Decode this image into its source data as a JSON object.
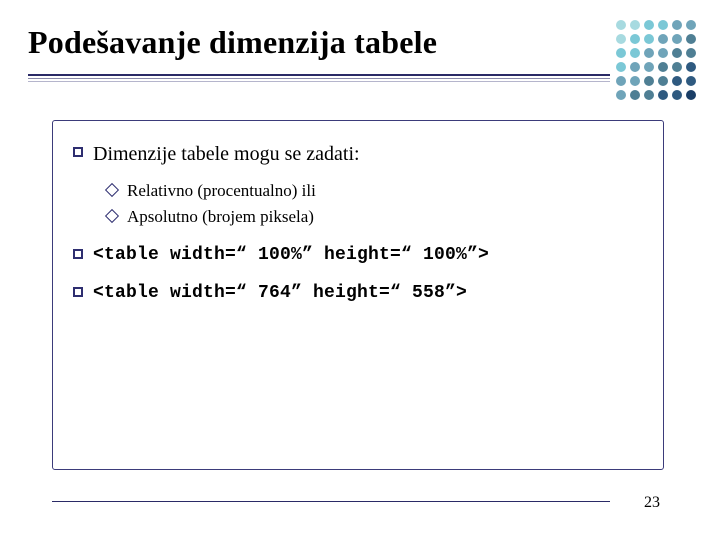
{
  "title": "Podešavanje dimenzija tabele",
  "bullets": [
    {
      "kind": "text",
      "text": "Dimenzije tabele mogu se zadati:",
      "children": [
        {
          "text": "Relativno (procentualno) ili"
        },
        {
          "text": "Apsolutno (brojem piksela)"
        }
      ]
    },
    {
      "kind": "code",
      "text": "<table width=“ 100%” height=“ 100%”>"
    },
    {
      "kind": "code",
      "text": "<table width=“ 764” height=“ 558”>"
    }
  ],
  "page_number": "23"
}
